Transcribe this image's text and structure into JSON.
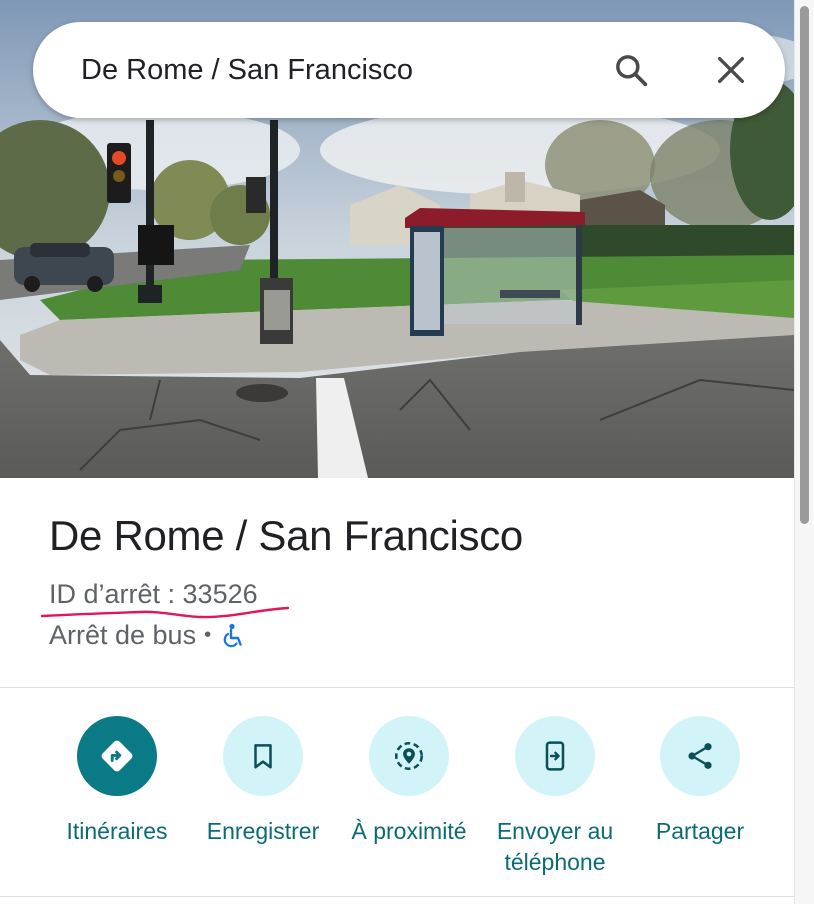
{
  "search": {
    "value": "De Rome / San Francisco",
    "search_icon": "search-icon",
    "close_icon": "close-icon"
  },
  "place": {
    "title": "De Rome / San Francisco",
    "stop_id": "ID d’arrêt : 33526",
    "type": "Arrêt de bus",
    "separator": "•",
    "accessibility_icon": "wheelchair-icon"
  },
  "actions": [
    {
      "label": "Itinéraires",
      "icon": "directions-icon"
    },
    {
      "label": "Enregistrer",
      "icon": "bookmark-icon"
    },
    {
      "label": "À proximité",
      "icon": "nearby-icon"
    },
    {
      "label": "Envoyer au téléphone",
      "icon": "send-to-phone-icon"
    },
    {
      "label": "Partager",
      "icon": "share-icon"
    }
  ],
  "colors": {
    "accent": "#0a7a86",
    "action_bg": "#d2f4f9",
    "annotation": "#e3165b",
    "accessibility": "#1a73e8"
  }
}
